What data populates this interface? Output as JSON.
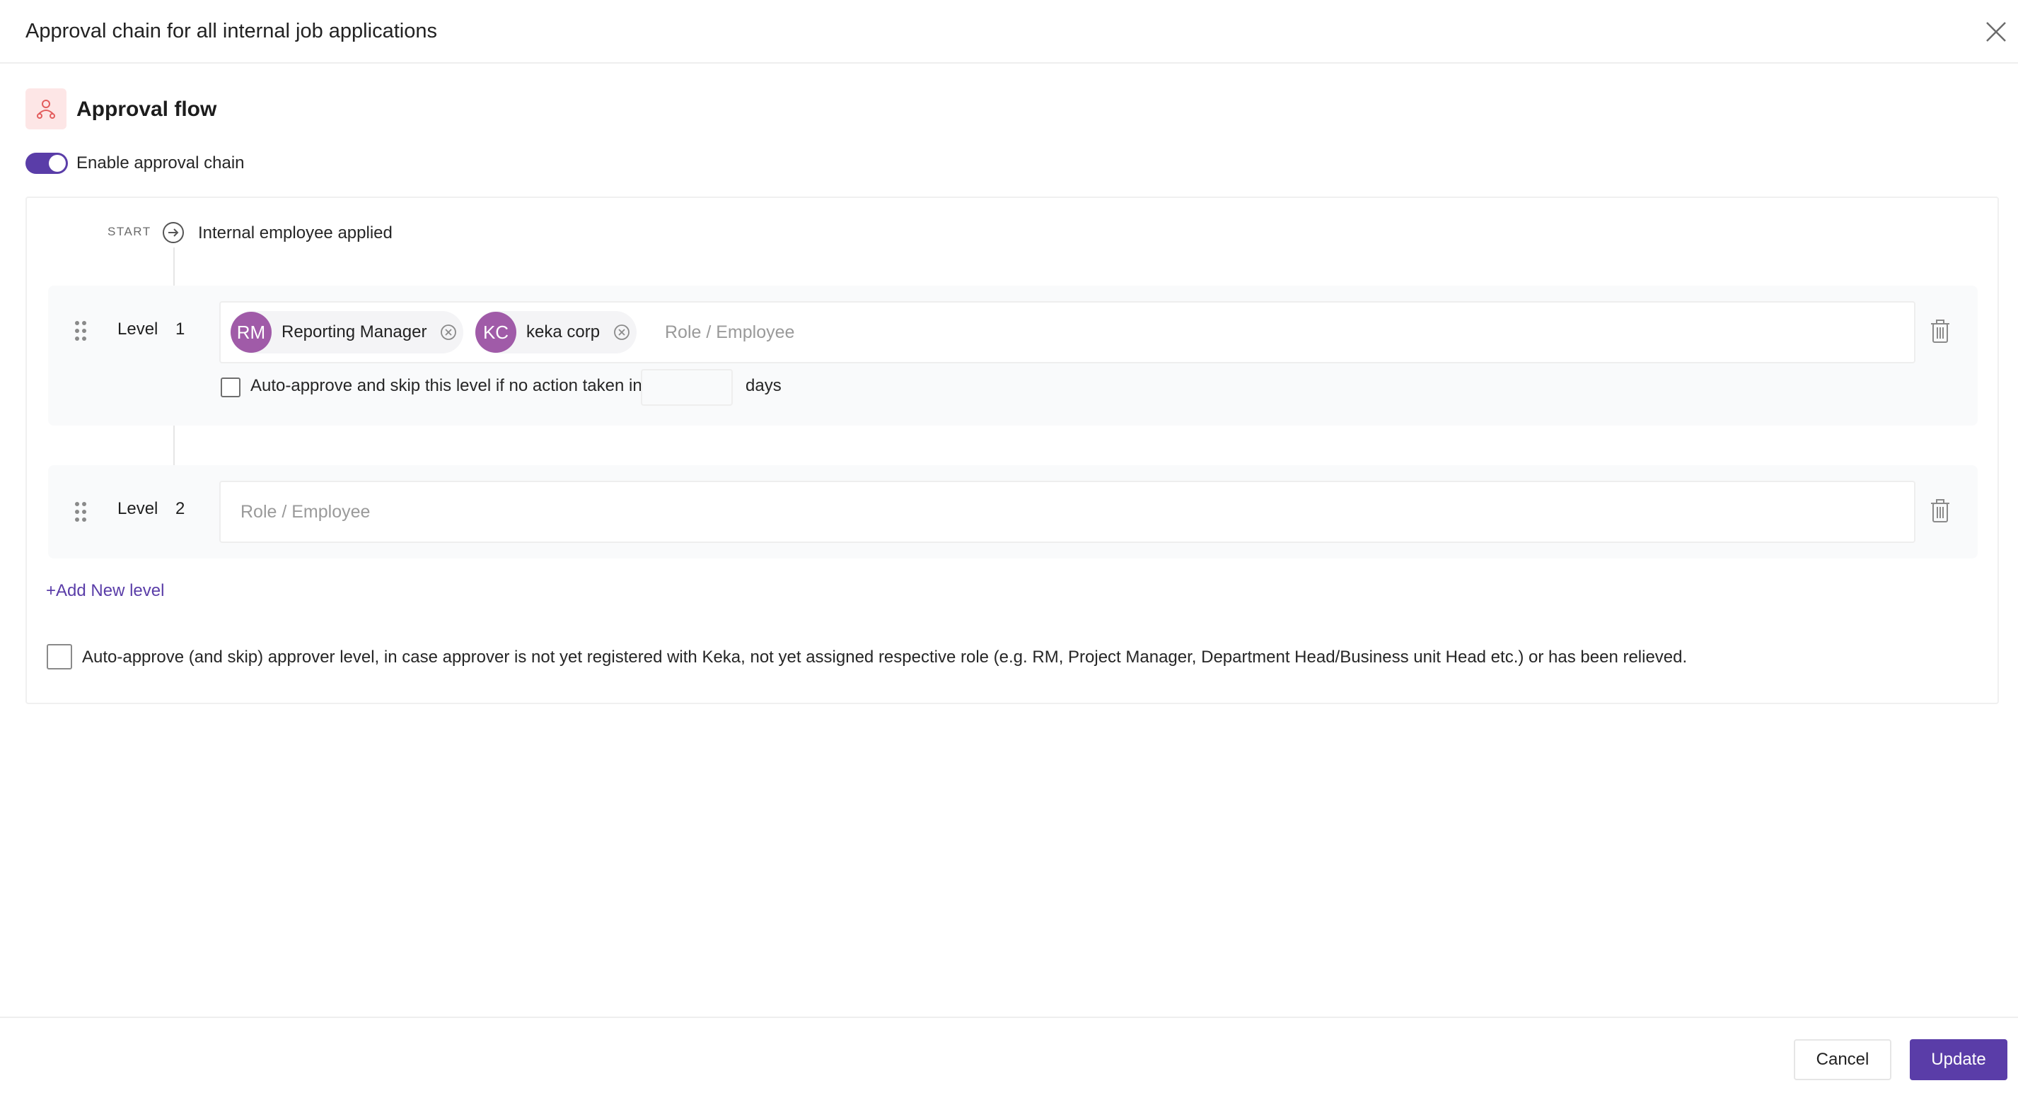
{
  "modal": {
    "title": "Approval chain for all internal job applications"
  },
  "section": {
    "title": "Approval flow",
    "icon": "person-flow-icon"
  },
  "toggle": {
    "label": "Enable approval chain",
    "enabled": true
  },
  "start": {
    "label": "START",
    "text": "Internal employee applied"
  },
  "levels": [
    {
      "label": "Level",
      "number": "1",
      "approvers": [
        {
          "initials": "RM",
          "name": "Reporting Manager"
        },
        {
          "initials": "KC",
          "name": "keka corp"
        }
      ],
      "placeholder": "Role / Employee",
      "auto_approve_label": "Auto-approve and skip this level if no action taken in",
      "days_value": "",
      "days_label": "days",
      "auto_approve_checked": false
    },
    {
      "label": "Level",
      "number": "2",
      "approvers": [],
      "placeholder": "Role / Employee"
    }
  ],
  "add_level_label": "+Add New level",
  "auto_skip": {
    "label": "Auto-approve (and skip) approver level, in case approver is not yet registered with Keka, not yet assigned respective role (e.g. RM, Project Manager, Department Head/Business unit Head etc.) or has been relieved.",
    "checked": false
  },
  "footer": {
    "cancel_label": "Cancel",
    "update_label": "Update"
  },
  "colors": {
    "accent": "#5a3da8",
    "avatar": "#a05ba8",
    "icon_bg": "#fde6e6",
    "icon_fg": "#e35d5d"
  }
}
